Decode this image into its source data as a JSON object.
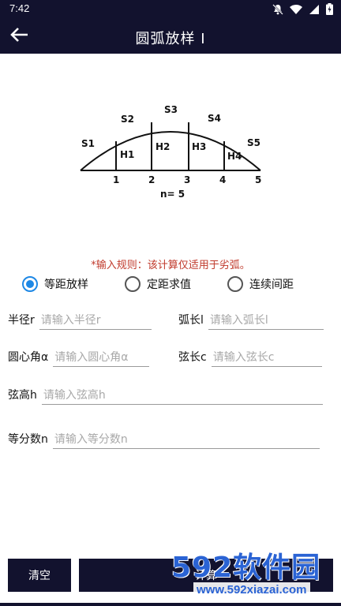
{
  "status_bar": {
    "time": "7:42",
    "icons": [
      "mute-icon",
      "wifi-icon",
      "signal-icon",
      "battery-charging-icon"
    ]
  },
  "app_bar": {
    "title": "圆弧放样 I",
    "back_icon": "back-arrow-icon"
  },
  "diagram": {
    "segment_labels": [
      "S1",
      "S2",
      "S3",
      "S4",
      "S5"
    ],
    "height_labels": [
      "H1",
      "H2",
      "H3",
      "H4"
    ],
    "point_labels": [
      "1",
      "2",
      "3",
      "4",
      "5"
    ],
    "n_label": "n= 5"
  },
  "rule_text": "*输入规则：该计算仅适用于劣弧。",
  "modes": [
    {
      "label": "等距放样",
      "checked": true
    },
    {
      "label": "定距求值",
      "checked": false
    },
    {
      "label": "连续间距",
      "checked": false
    }
  ],
  "fields": {
    "radius": {
      "label": "半径r",
      "placeholder": "请输入半径r"
    },
    "arc_length": {
      "label": "弧长l",
      "placeholder": "请输入弧长l"
    },
    "central_angle": {
      "label": "圆心角α",
      "placeholder": "请输入圆心角α"
    },
    "chord_length": {
      "label": "弦长c",
      "placeholder": "请输入弦长c"
    },
    "chord_height": {
      "label": "弦高h",
      "placeholder": "请输入弦高h"
    },
    "divisions": {
      "label": "等分数n",
      "placeholder": "请输入等分数n"
    }
  },
  "buttons": {
    "clear": "清空",
    "calculate": "计算"
  },
  "watermark": {
    "logo": "592软件园",
    "url": "www.592xiazai.com"
  },
  "colors": {
    "primary_dark": "#12122e",
    "accent_blue": "#1e88e5",
    "rule_red": "#c0392b"
  }
}
